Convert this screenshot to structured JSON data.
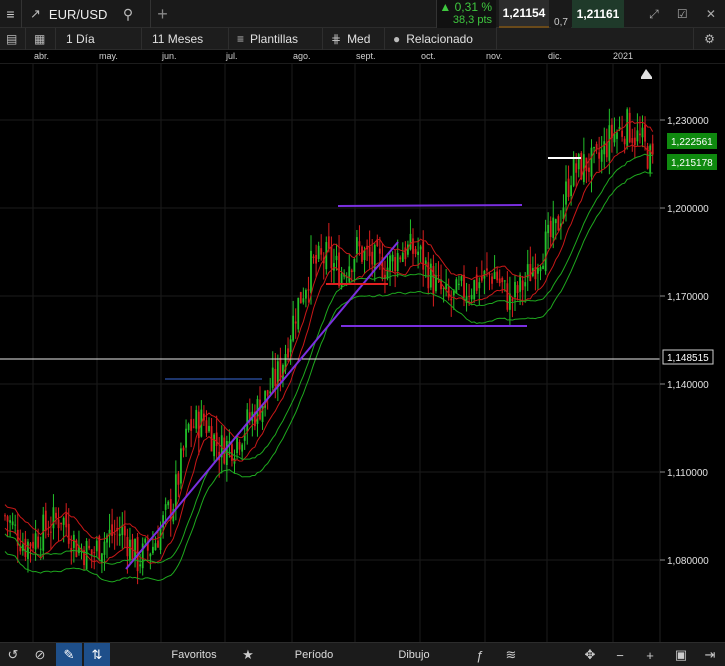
{
  "header": {
    "symbol": "EUR/USD",
    "change_pct": "▲ 0,31 %",
    "change_pts": "38,3 pts",
    "bid": "1,21154",
    "spread": "0,7",
    "ask": "1,21161"
  },
  "toolbar": {
    "interval": "1 Día",
    "range": "11 Meses",
    "templates": "Plantillas",
    "chart_style": "Med",
    "related": "Relacionado"
  },
  "months": [
    "abr.",
    "may.",
    "jun.",
    "jul.",
    "ago.",
    "sept.",
    "oct.",
    "nov.",
    "dic.",
    "2021"
  ],
  "price_axis": {
    "ticks": [
      "1,230000",
      "1,200000",
      "1,170000",
      "1,140000",
      "1,110000",
      "1,080000"
    ],
    "tags": {
      "upper": "1,222561",
      "lower": "1,215178",
      "level": "1,148515"
    }
  },
  "bottom": {
    "favorites": "Favoritos",
    "period": "Período",
    "drawing": "Dibujo"
  },
  "colors": {
    "up": "#22c02a",
    "down": "#d81e1e",
    "trend": "#7a2fe0",
    "green_tag": "#0f8a0f"
  },
  "chart_data": {
    "type": "candlestick",
    "x": [
      "abr.",
      "may.",
      "jun.",
      "jul.",
      "ago.",
      "sept.",
      "oct.",
      "nov.",
      "dic.",
      "2021"
    ],
    "ylim": [
      1.065,
      1.245
    ],
    "yticks": [
      1.08,
      1.11,
      1.14,
      1.17,
      1.2,
      1.23
    ],
    "close_approx": [
      1.09,
      1.082,
      1.125,
      1.145,
      1.185,
      1.178,
      1.172,
      1.175,
      1.215,
      1.2225
    ],
    "horizontal_level": 1.148515
  }
}
